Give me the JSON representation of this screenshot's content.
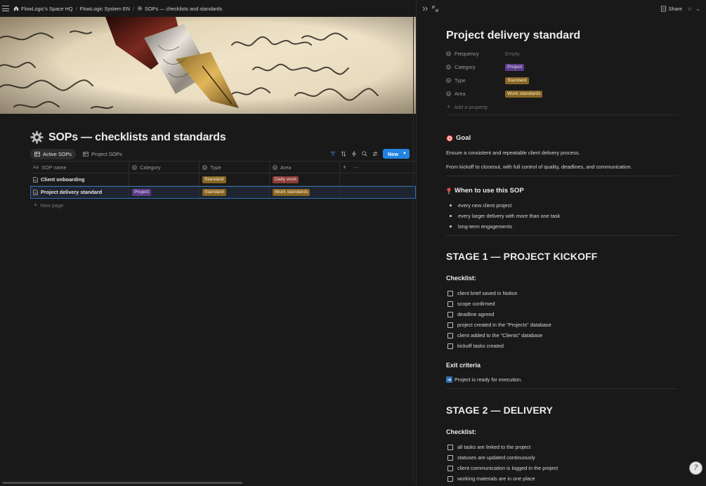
{
  "breadcrumb": {
    "workspace": "FlowLogic's Space HQ",
    "system": "FlowLogic System EN",
    "page": "SOPs — checklists and standards"
  },
  "database": {
    "title": "SOPs — checklists and standards",
    "views": [
      {
        "label": "Active SOPs",
        "active": true
      },
      {
        "label": "Project SOPs",
        "active": false
      }
    ],
    "new_label": "New",
    "columns": [
      "SOP name",
      "Category",
      "Type",
      "Area"
    ],
    "rows": [
      {
        "name": "Client onboarding",
        "category": "",
        "type": "Standard",
        "area": "Daily work"
      },
      {
        "name": "Project delivery standard",
        "category": "Project",
        "type": "Standard",
        "area": "Work standards"
      }
    ],
    "new_page_label": "New page"
  },
  "colors": {
    "accent": "#2383e2",
    "tag_purple": "#5a3c88",
    "tag_gold": "#876524",
    "tag_red": "#8b3d38"
  },
  "detail": {
    "share_label": "Share",
    "title": "Project delivery standard",
    "properties": [
      {
        "label": "Frequency",
        "value": "Empty"
      },
      {
        "label": "Category",
        "value": "Project"
      },
      {
        "label": "Type",
        "value": "Standard"
      },
      {
        "label": "Area",
        "value": "Work standards"
      }
    ],
    "add_property": "Add a property",
    "goal": {
      "heading": "Goal",
      "p1": "Ensure a consistent and repeatable client delivery process.",
      "p2": "From kickoff to closeout, with full control of quality, deadlines, and communication."
    },
    "when": {
      "heading": "When to use this SOP",
      "items": [
        "every new client project",
        "every larger delivery with more than one task",
        "long-term engagements"
      ]
    },
    "stage1": {
      "heading": "STAGE 1 — PROJECT KICKOFF",
      "checklist_label": "Checklist:",
      "items": [
        "client brief saved in Notion",
        "scope confirmed",
        "deadline agreed",
        "project created in the \"Projects\" database",
        "client added to the \"Clients\" database",
        "kickoff tasks created"
      ],
      "exit_label": "Exit criteria",
      "exit_text": "Project is ready for execution."
    },
    "stage2": {
      "heading": "STAGE 2 — DELIVERY",
      "checklist_label": "Checklist:",
      "items": [
        "all tasks are linked to the project",
        "statuses are updated continuously",
        "client communication is logged in the project",
        "working materials are in one place"
      ]
    }
  }
}
